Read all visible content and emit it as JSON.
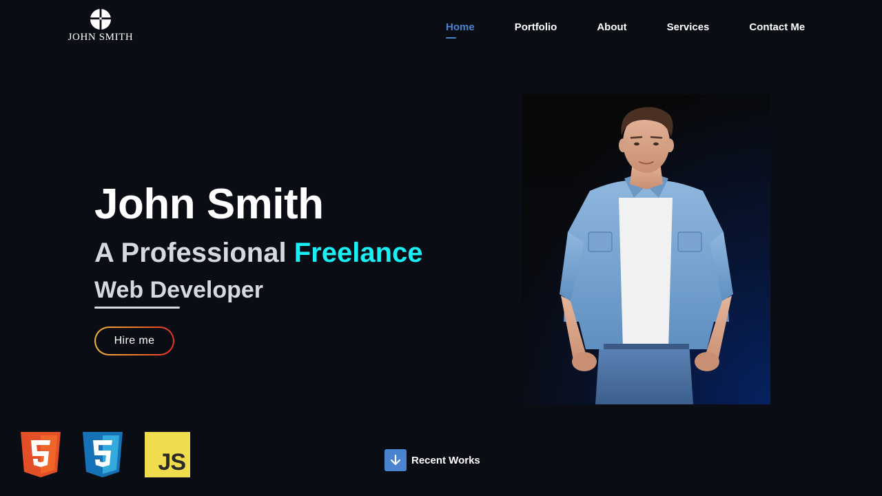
{
  "brand": {
    "name": "JOHN SMITH",
    "logo_icon": "cross-circle-icon"
  },
  "nav": {
    "items": [
      {
        "label": "Home",
        "active": true
      },
      {
        "label": "Portfolio",
        "active": false
      },
      {
        "label": "About",
        "active": false
      },
      {
        "label": "Services",
        "active": false
      },
      {
        "label": "Contact Me",
        "active": false
      }
    ],
    "active_color": "#4a83cf"
  },
  "hero": {
    "name": "John Smith",
    "line1_prefix": "A Professional ",
    "line1_accent": "Freelance",
    "line2": "Web Developer",
    "accent_color": "#18f0f6",
    "cta_label": "Hire me"
  },
  "portrait": {
    "subject": "man-in-denim-shirt-photo"
  },
  "tech_icons": [
    {
      "name": "html5-icon",
      "color": "#e34f26"
    },
    {
      "name": "css3-icon",
      "color": "#1572b6"
    },
    {
      "name": "javascript-icon",
      "label": "JS",
      "color": "#f1dc4e"
    }
  ],
  "recent_works": {
    "label": "Recent Works",
    "icon": "arrow-down-icon"
  },
  "colors": {
    "background": "#0b0d15",
    "text_primary": "#ffffff",
    "text_secondary": "#d7d9e1"
  }
}
